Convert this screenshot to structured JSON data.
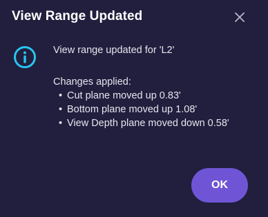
{
  "dialog": {
    "title": "View Range Updated",
    "close_icon": "close-icon",
    "status_icon": "info-icon",
    "message": "View range updated for 'L2'",
    "changes_heading": "Changes applied:",
    "changes": [
      "Cut plane moved up 0.83'",
      "Bottom plane moved up 1.08'",
      "View Depth plane moved down 0.58'"
    ],
    "ok_label": "OK"
  },
  "colors": {
    "background": "#211f3d",
    "accent": "#6f55d6",
    "info_icon": "#27c6f0",
    "text": "#e6e5ef"
  }
}
